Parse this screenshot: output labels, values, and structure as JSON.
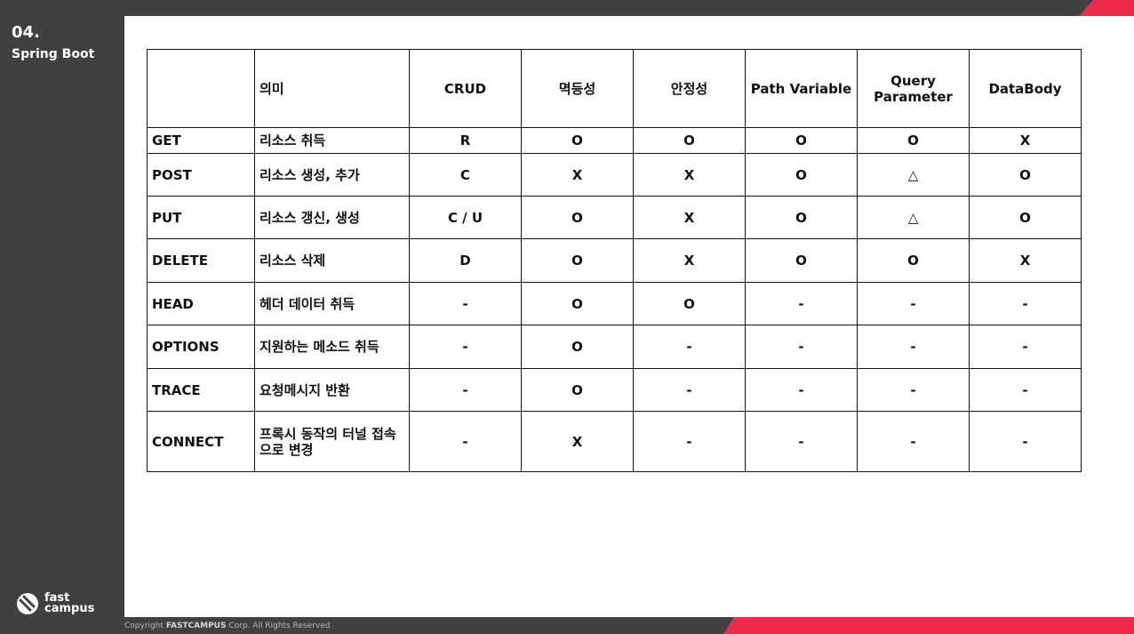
{
  "slide": {
    "section_number": "04.",
    "section_title": "Spring Boot",
    "logo_line1": "fast",
    "logo_line2": "campus",
    "copyright_prefix": "Copyright",
    "copyright_brand": "FASTCAMPUS",
    "copyright_suffix": "Corp. All Rights Reserved"
  },
  "table": {
    "headers": [
      "",
      "의미",
      "CRUD",
      "멱등성",
      "안정성",
      "Path Variable",
      "Query Parameter",
      "DataBody"
    ],
    "rows": [
      [
        "GET",
        "리소스 취득",
        "R",
        "O",
        "O",
        "O",
        "O",
        "X"
      ],
      [
        "POST",
        "리소스 생성, 추가",
        "C",
        "X",
        "X",
        "O",
        "△",
        "O"
      ],
      [
        "PUT",
        "리소스 갱신, 생성",
        "C / U",
        "O",
        "X",
        "O",
        "△",
        "O"
      ],
      [
        "DELETE",
        "리소스 삭제",
        "D",
        "O",
        "X",
        "O",
        "O",
        "X"
      ],
      [
        "HEAD",
        "헤더 데이터 취득",
        "-",
        "O",
        "O",
        "-",
        "-",
        "-"
      ],
      [
        "OPTIONS",
        "지원하는 메소드 취득",
        "-",
        "O",
        "-",
        "-",
        "-",
        "-"
      ],
      [
        "TRACE",
        "요청메시지 반환",
        "-",
        "O",
        "-",
        "-",
        "-",
        "-"
      ],
      [
        "CONNECT",
        "프록시 동작의 터널 접속으로 변경",
        "-",
        "X",
        "-",
        "-",
        "-",
        "-"
      ]
    ]
  },
  "colors": {
    "dark": "#404040",
    "accent": "#ee2a4c"
  }
}
